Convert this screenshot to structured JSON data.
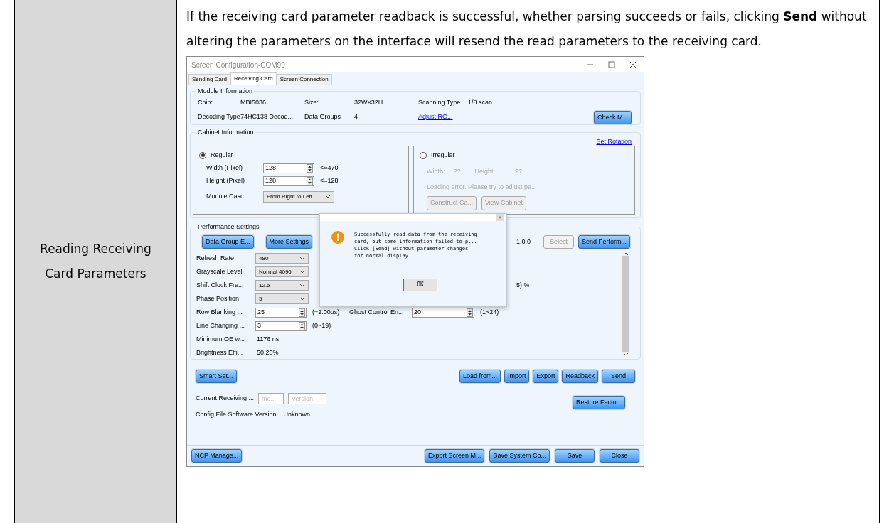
{
  "row_label": "Reading Receiving Card Parameters",
  "description": "If the receiving card parameter readback is successful, whether parsing succeeds or fails, clicking **Send** without altering the parameters on the interface will resend the read parameters to the receiving card.",
  "window": {
    "title": "Screen Configuration-COM99",
    "tabs": [
      {
        "label": "Sending Card",
        "selected": false
      },
      {
        "label": "Receiving Card",
        "selected": true
      },
      {
        "label": "Screen Connection",
        "selected": false
      }
    ],
    "module_info": {
      "title": "Module Information",
      "fields": [
        {
          "label": "Chip:",
          "value": "MBI5036"
        },
        {
          "label": "Size:",
          "value": "32W×32H"
        },
        {
          "label": "Scanning Type",
          "value": "1/8 scan"
        },
        {
          "label": "Decoding Type",
          "value": "74HC138 Decod..."
        },
        {
          "label": "Data Groups",
          "value": "4"
        }
      ],
      "link": "Adjust RG...",
      "button": "Check M..."
    },
    "cabinet_info": {
      "title": "Cabinet Information",
      "link": "Set Rotation",
      "regular": {
        "label": "Regular",
        "selected": true,
        "fields": [
          {
            "label": "Width (Pixel)",
            "value": "128",
            "range": "<=470"
          },
          {
            "label": "Height (Pixel)",
            "value": "128",
            "range": "<=128"
          }
        ],
        "cascade_label": "Module Casc...",
        "cascade_value": "From Right to Left"
      },
      "irregular": {
        "label": "Irregular",
        "selected": false,
        "width_label": "Width:",
        "width_value": "??",
        "height_label": "Height:",
        "height_value": "??",
        "error": "Loading error. Please try to adjust pe...",
        "buttons": [
          "Construct Ca...",
          "View Cabinet"
        ]
      }
    },
    "performance": {
      "title": "Performance Settings",
      "buttons": [
        "Data Group E...",
        "More Settings"
      ],
      "version": "1.0.0",
      "select_button": "Select",
      "send_button": "Send Perform...",
      "partial_text": "5) %",
      "rows": [
        {
          "kind": "dropdown",
          "label": "Refresh Rate",
          "value": "480"
        },
        {
          "kind": "dropdown",
          "label": "Grayscale Level",
          "value": "Normal 4096"
        },
        {
          "kind": "dropdown",
          "label": "Shift Clock Fre...",
          "value": "12.5"
        },
        {
          "kind": "dropdown",
          "label": "Phase Position",
          "value": "5"
        },
        {
          "kind": "spinner",
          "label": "Row Blanking ...",
          "value": "25",
          "note": "(=2.00us)",
          "right": {
            "label": "Ghost Control En...",
            "value": "20",
            "note": "(1~24)"
          }
        },
        {
          "kind": "spinner",
          "label": "Line Changing ...",
          "value": "3",
          "note": "(0~19)"
        },
        {
          "kind": "text",
          "label": "Minimum OE w...",
          "value": "1176 ns"
        },
        {
          "kind": "text",
          "label": "Brightness Effi...",
          "value": "50.20%"
        }
      ]
    },
    "actions": {
      "smart_button": "Smart Set...",
      "buttons": [
        "Load from...",
        "Import",
        "Export",
        "Readback",
        "Send"
      ],
      "current_label": "Current Receiving ...",
      "fields": [
        {
          "placeholder": "mo..."
        },
        {
          "placeholder": "Version:"
        }
      ],
      "restore_button": "Restore Facto...",
      "config_label": "Config File Software Version",
      "config_value": "Unknown"
    },
    "footer": {
      "left_buttons": [
        "NCP Manage..."
      ],
      "right_buttons": [
        "Export Screen M...",
        "Save System Co...",
        "Save",
        "Close"
      ]
    },
    "dialog": {
      "close": "x",
      "lines": [
        "Successfully read data from the receiving",
        "card, but some information failed to p...",
        "Click [Send] without parameter changes",
        "for normal display."
      ],
      "button": "OK"
    }
  }
}
